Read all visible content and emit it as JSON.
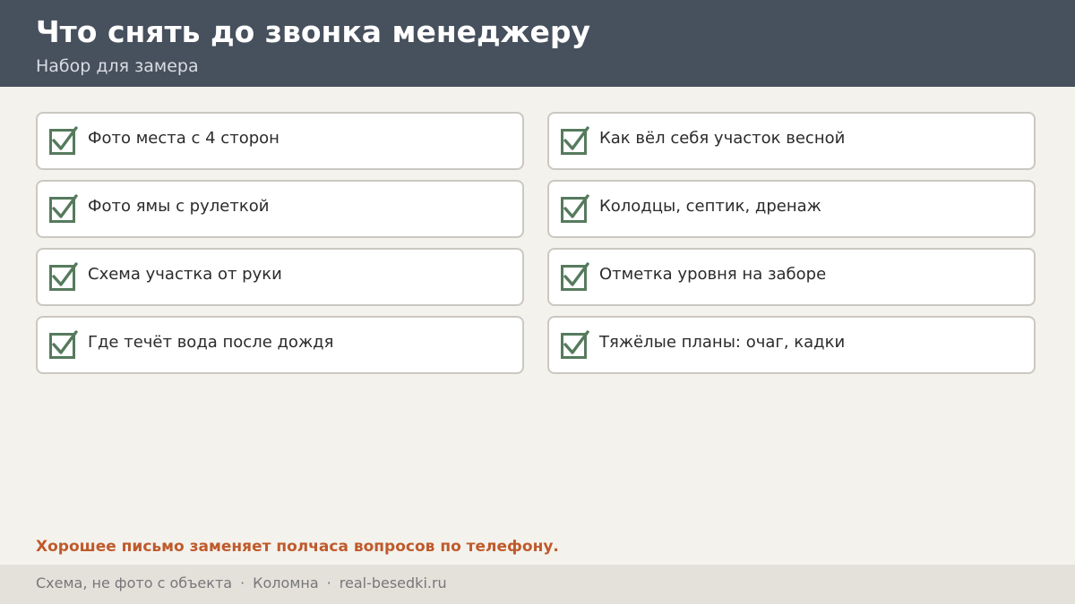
{
  "header": {
    "title": "Что снять до звонка менеджеру",
    "subtitle": "Набор для замера"
  },
  "checklist": {
    "items": [
      "Фото места с 4 сторон",
      "Как вёл себя участок весной",
      "Фото ямы с рулеткой",
      "Колодцы, септик, дренаж",
      "Схема участка от руки",
      "Отметка уровня на заборе",
      "Где течёт вода после дождя",
      "Тяжёлые планы: очаг, кадки"
    ]
  },
  "tip": "Хорошее письмо заменяет полчаса вопросов по телефону.",
  "footer": {
    "note": "Схема, не фото с объекта",
    "city": "Коломна",
    "site": "real-besedki.ru",
    "separator": "·"
  },
  "colors": {
    "header_bg": "#47505d",
    "page_bg": "#f4f2ed",
    "check": "#567a5d",
    "accent": "#bf5a2b",
    "footer_bg": "#e4e1da"
  },
  "icons": {
    "checkbox": "checkbox-checked-icon"
  }
}
